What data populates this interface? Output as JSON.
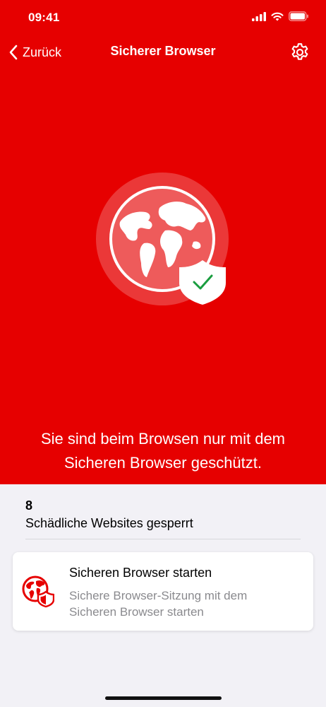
{
  "status_bar": {
    "time": "09:41"
  },
  "nav": {
    "back_label": "Zurück",
    "title": "Sicherer Browser"
  },
  "hero": {
    "message": "Sie sind beim Browsen nur mit dem Sicheren Browser geschützt."
  },
  "stats": {
    "count": "8",
    "label": "Schädliche Websites gesperrt"
  },
  "action_card": {
    "title": "Sicheren Browser starten",
    "description": "Sichere Browser-Sitzung mit dem Sicheren Browser starten"
  },
  "colors": {
    "brand_red": "#e60000",
    "check_green": "#1a9d3f",
    "background": "#f2f1f6"
  },
  "icons": [
    "back-chevron",
    "gear",
    "globe",
    "shield-check",
    "globe-shield"
  ]
}
